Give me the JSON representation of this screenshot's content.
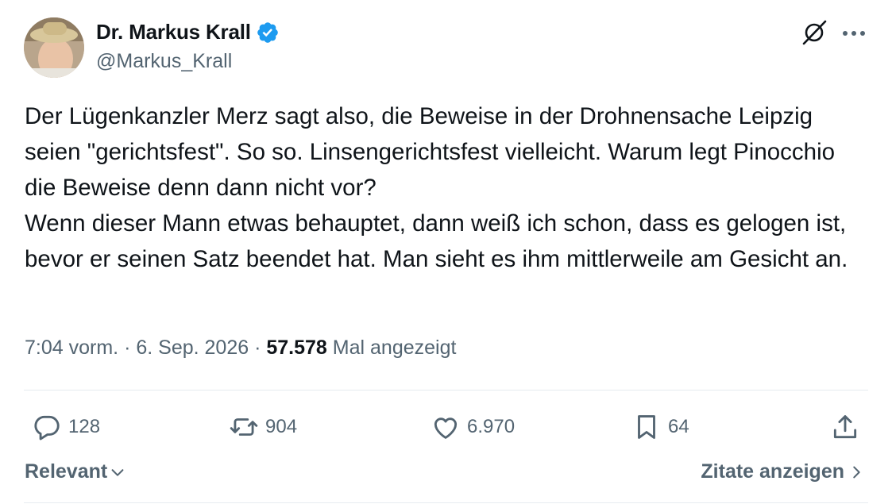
{
  "author": {
    "name": "Dr. Markus Krall",
    "handle": "@Markus_Krall",
    "verified": true,
    "verified_color": "#1d9bf0"
  },
  "tweet": {
    "text": "Der Lügenkanzler Merz sagt also, die Beweise in der Drohnensache Leipzig seien \"gerichtsfest\". So so. Linsengerichtsfest vielleicht. Warum legt Pinocchio die Beweise denn dann nicht vor?\nWenn dieser Mann etwas behauptet, dann weiß ich schon, dass es gelogen ist, bevor er seinen Satz beendet hat. Man sieht es ihm mittlerweile am Gesicht an.",
    "time": "7:04 vorm.",
    "date": "6. Sep. 2026",
    "views": "57.578",
    "views_label": "Mal angezeigt"
  },
  "actions": {
    "replies": "128",
    "reposts": "904",
    "likes": "6.970",
    "bookmarks": "64"
  },
  "footer": {
    "sort_label": "Relevant",
    "quotes_label": "Zitate anzeigen"
  },
  "icons": [
    "grok-icon",
    "more-icon",
    "reply-icon",
    "repost-icon",
    "like-icon",
    "bookmark-icon",
    "share-icon",
    "chevron-down-icon",
    "chevron-right-icon"
  ]
}
